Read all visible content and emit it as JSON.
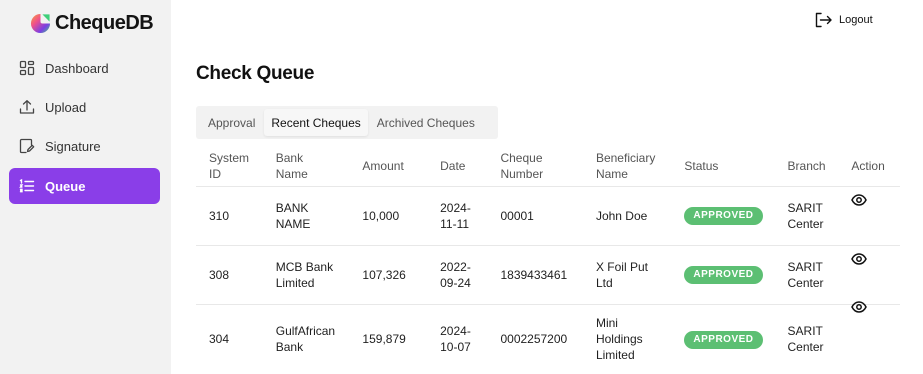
{
  "brand": {
    "name": "ChequeDB"
  },
  "sidebar": {
    "items": [
      {
        "label": "Dashboard",
        "icon": "dashboard-icon",
        "active": false
      },
      {
        "label": "Upload",
        "icon": "upload-icon",
        "active": false
      },
      {
        "label": "Signature",
        "icon": "signature-icon",
        "active": false
      },
      {
        "label": "Queue",
        "icon": "queue-list-icon",
        "active": true
      }
    ]
  },
  "header": {
    "logout_label": "Logout"
  },
  "main": {
    "title": "Check Queue",
    "tabs": [
      {
        "label": "Approval",
        "active": false
      },
      {
        "label": "Recent Cheques",
        "active": true
      },
      {
        "label": "Archived Cheques",
        "active": false
      }
    ],
    "table": {
      "headers": {
        "system_id": [
          "System",
          "ID"
        ],
        "bank_name": [
          "Bank",
          "Name"
        ],
        "amount": "Amount",
        "date": "Date",
        "cheque_number": [
          "Cheque",
          "Number"
        ],
        "beneficiary": [
          "Beneficiary",
          "Name"
        ],
        "status": "Status",
        "branch": "Branch",
        "action": "Action"
      },
      "rows": [
        {
          "system_id": "310",
          "bank": [
            "BANK",
            "NAME"
          ],
          "amount": "10,000",
          "date": [
            "2024-",
            "11-11"
          ],
          "cheque_number": "00001",
          "beneficiary": [
            "John Doe"
          ],
          "status": "APPROVED",
          "branch": [
            "SARIT",
            "Center"
          ]
        },
        {
          "system_id": "308",
          "bank": [
            "MCB Bank",
            "Limited"
          ],
          "amount": "107,326",
          "date": [
            "2022-",
            "09-24"
          ],
          "cheque_number": "1839433461",
          "beneficiary": [
            "X Foil Put",
            "Ltd"
          ],
          "status": "APPROVED",
          "branch": [
            "SARIT",
            "Center"
          ]
        },
        {
          "system_id": "304",
          "bank": [
            "GulfAfrican",
            "Bank"
          ],
          "amount": "159,879",
          "date": [
            "2024-",
            "10-07"
          ],
          "cheque_number": "0002257200",
          "beneficiary": [
            "Mini",
            "Holdings",
            "Limited"
          ],
          "status": "APPROVED",
          "branch": [
            "SARIT",
            "Center"
          ]
        }
      ]
    }
  },
  "colors": {
    "accent": "#8a3ee8",
    "status_approved": "#5cbf73",
    "sidebar_bg": "#f2f2f2",
    "logo_purple": "#7b3fe4",
    "logo_pink": "#f0508a",
    "logo_green": "#3fcf7a",
    "logo_orange": "#f7a23b"
  }
}
